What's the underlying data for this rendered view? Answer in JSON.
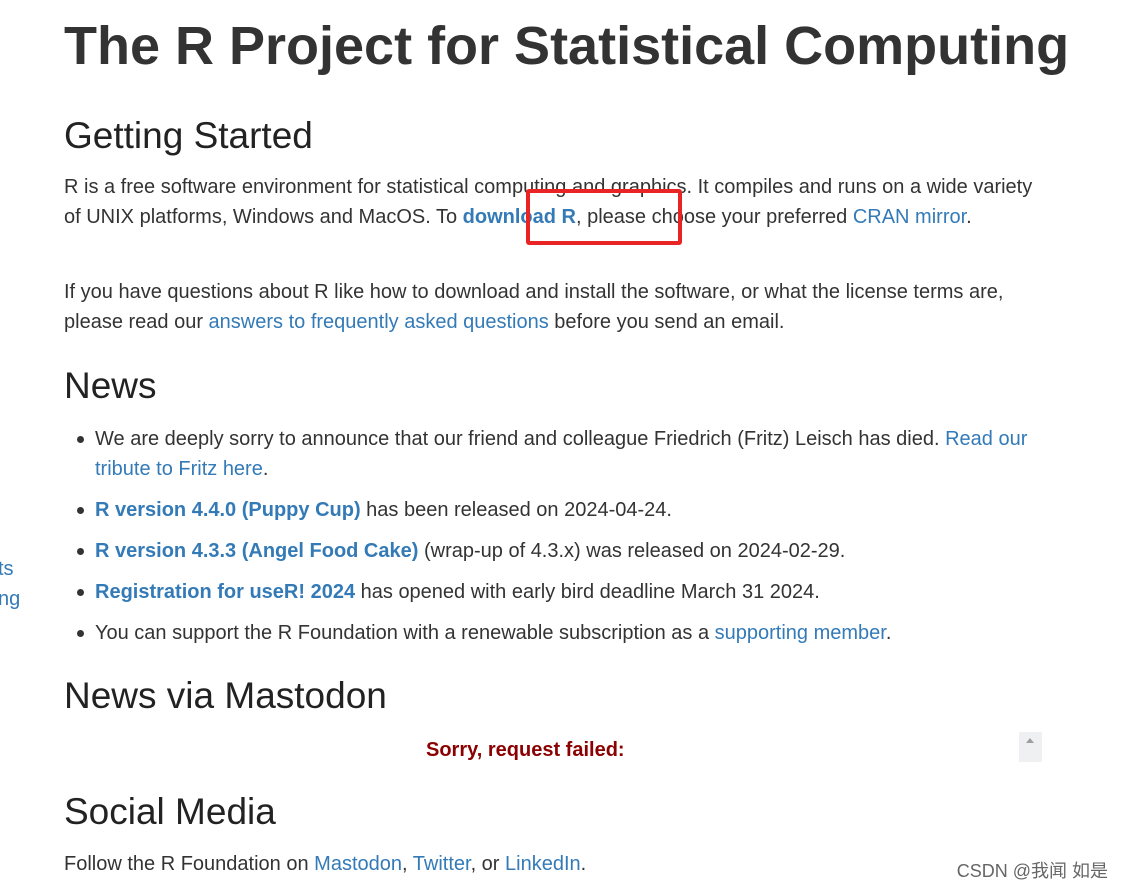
{
  "sidebar_fragments": [
    "ts",
    "ng"
  ],
  "title": "The R Project for Statistical Computing",
  "getting_started": {
    "heading": "Getting Started",
    "p1_text1": "R is a free software environment for statistical computing and graphics. It compiles and runs on a wide variety of UNIX platforms, Windows and MacOS. To ",
    "p1_link_download": "download R",
    "p1_text2": ", please choose your preferred ",
    "p1_link_cran": "CRAN mirror",
    "p1_text3": ".",
    "p2_text1": "If you have questions about R like how to download and install the software, or what the license terms are, please read our ",
    "p2_link_faq": "answers to frequently asked questions",
    "p2_text2": " before you send an email."
  },
  "news": {
    "heading": "News",
    "items": [
      {
        "text1": "We are deeply sorry to announce that our friend and colleague Friedrich (Fritz) Leisch has died. ",
        "link": "Read our tribute to Fritz here",
        "text2": "."
      },
      {
        "link": "R version 4.4.0 (Puppy Cup)",
        "text2": " has been released on 2024-04-24."
      },
      {
        "link": "R version 4.3.3 (Angel Food Cake)",
        "text2": " (wrap-up of 4.3.x) was released on 2024-02-29."
      },
      {
        "link": "Registration for useR! 2024",
        "text2": " has opened with early bird deadline March 31 2024."
      },
      {
        "text1": "You can support the R Foundation with a renewable subscription as a ",
        "link": "supporting member",
        "text2": "."
      }
    ]
  },
  "mastodon": {
    "heading": "News via Mastodon",
    "error": "Sorry, request failed:"
  },
  "social": {
    "heading": "Social Media",
    "text1": "Follow the R Foundation on ",
    "link_mastodon": "Mastodon",
    "sep1": ", ",
    "link_twitter": "Twitter",
    "sep2": ", or ",
    "link_linkedin": "LinkedIn",
    "text2": "."
  },
  "watermark": "CSDN @我闻 如是",
  "colors": {
    "link": "#337ab7",
    "text": "#333333",
    "error": "#8b0000",
    "highlight": "#e82424"
  }
}
